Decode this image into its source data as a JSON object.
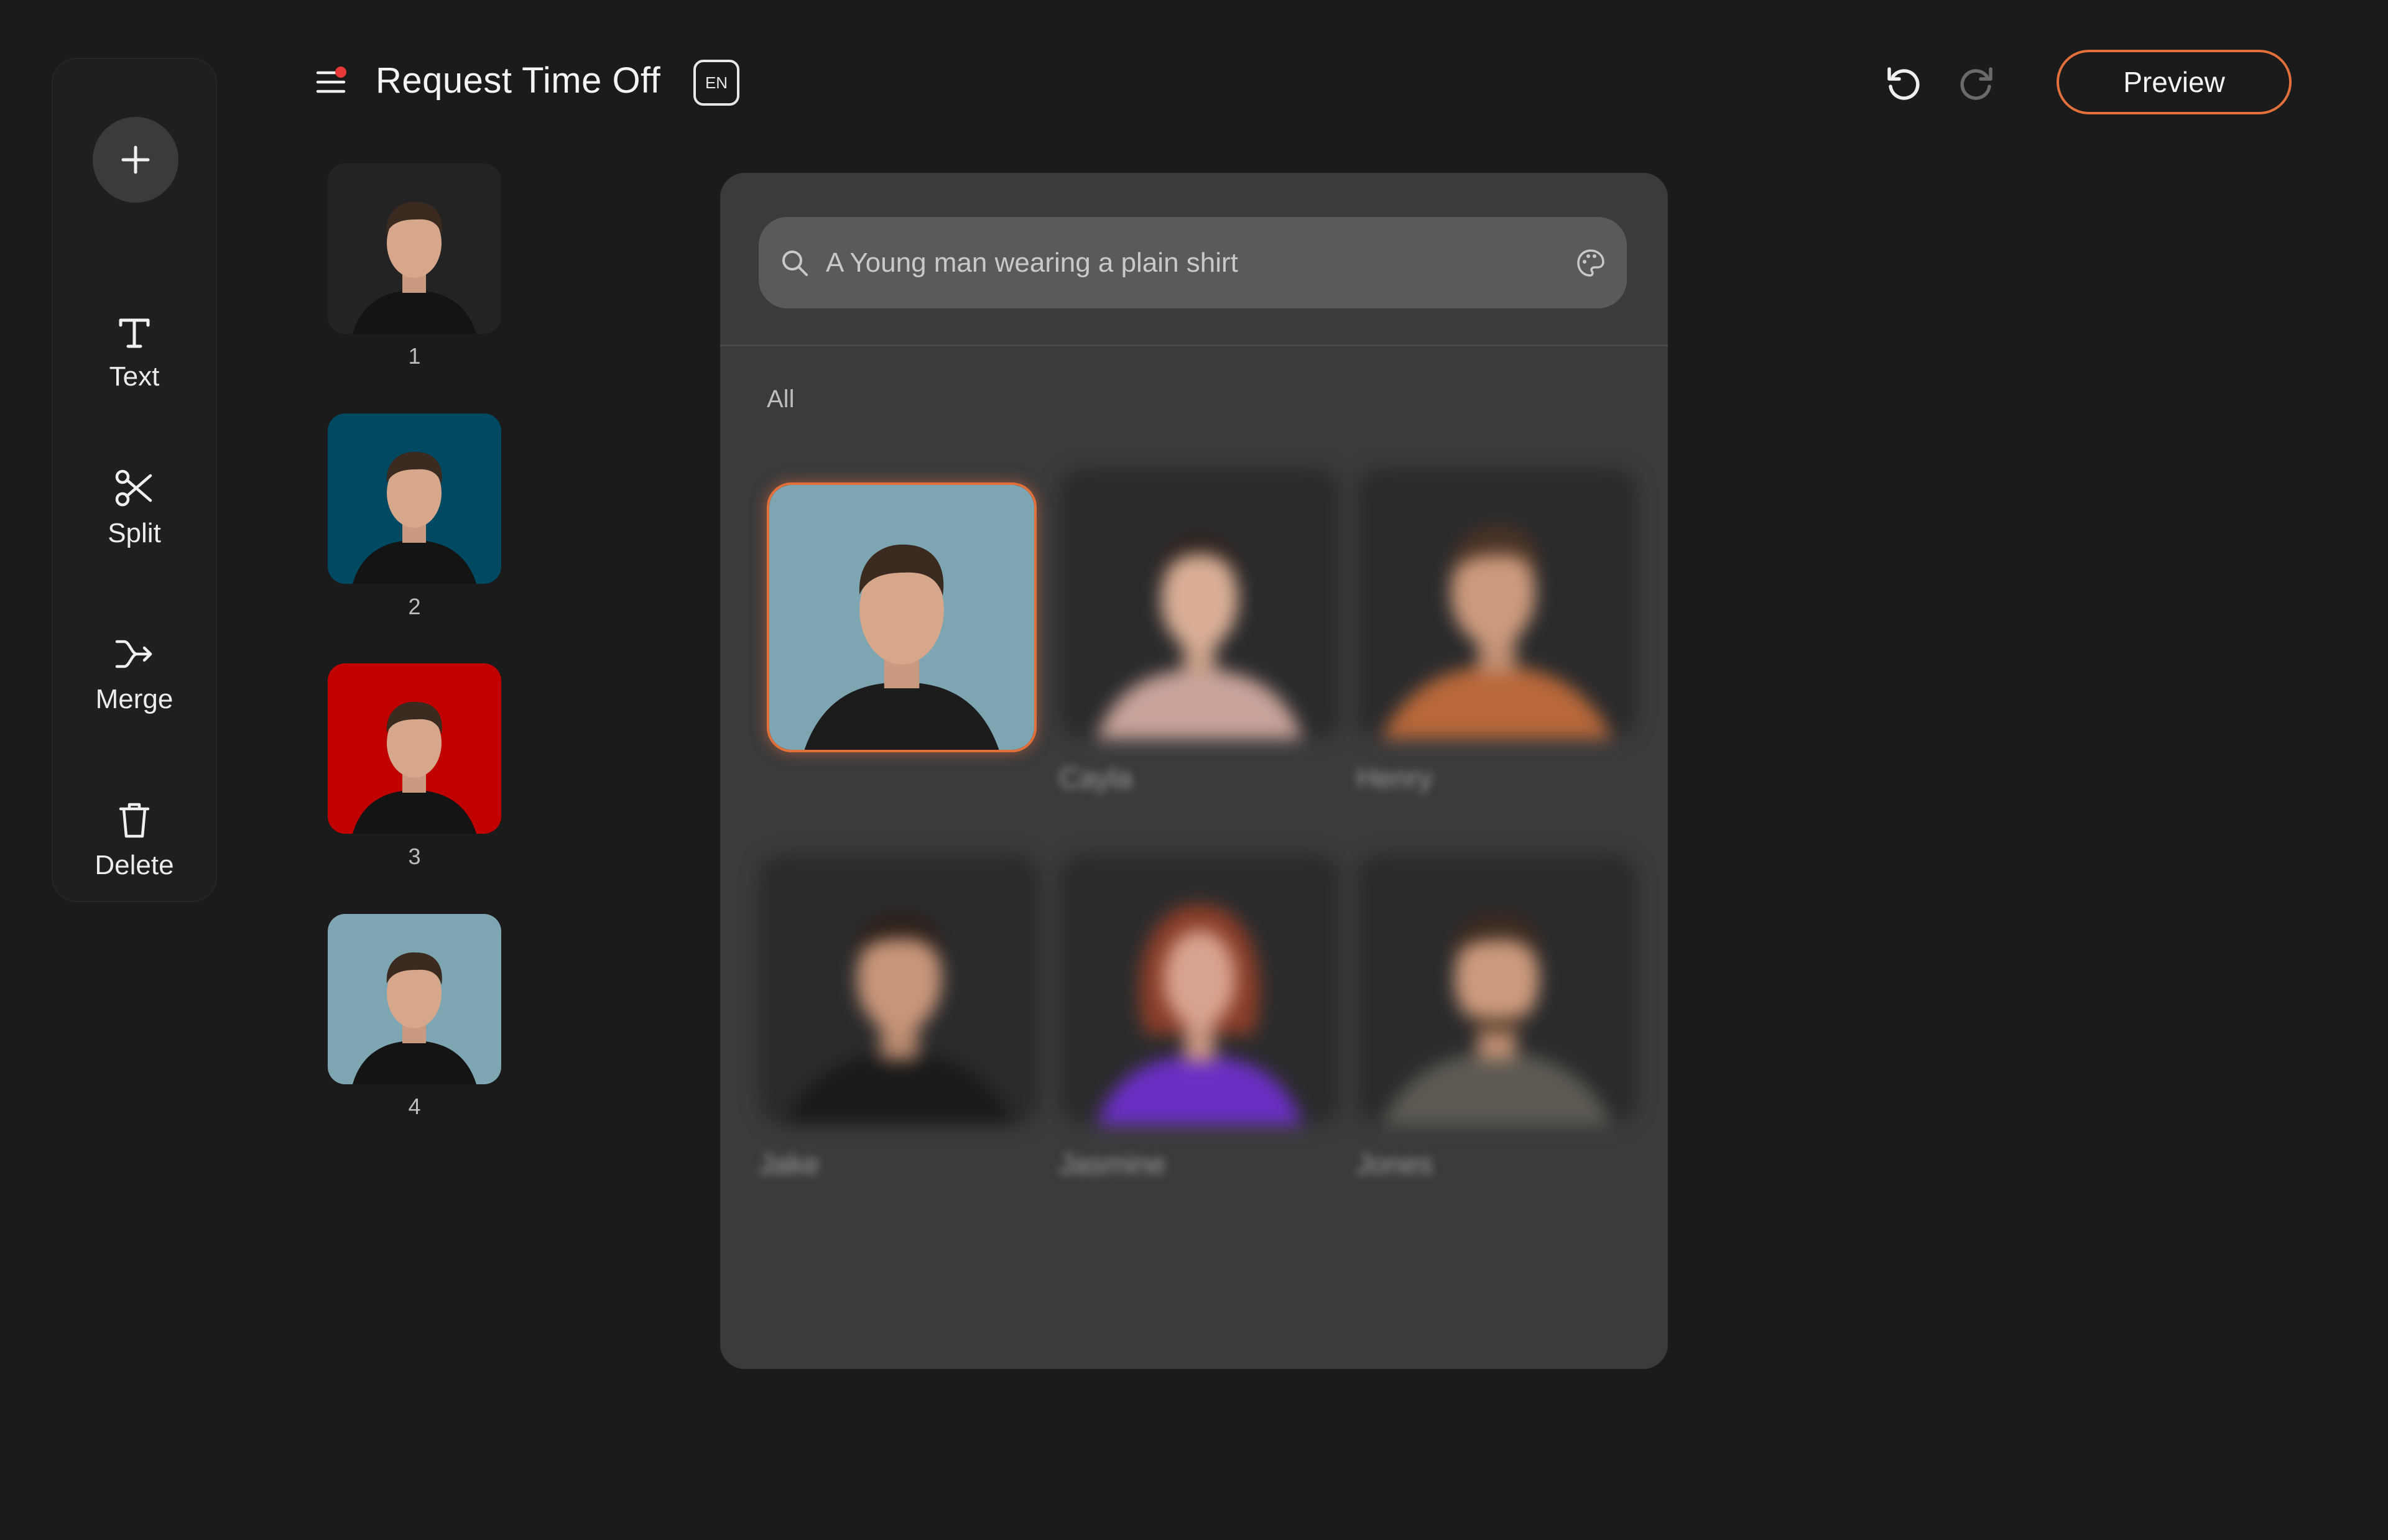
{
  "header": {
    "title": "Request Time Off",
    "language": "EN",
    "preview_label": "Preview"
  },
  "tools": {
    "add_icon": "plus-icon",
    "items": [
      {
        "label": "Text",
        "icon": "text-icon"
      },
      {
        "label": "Split",
        "icon": "scissors-icon"
      },
      {
        "label": "Merge",
        "icon": "merge-icon"
      },
      {
        "label": "Delete",
        "icon": "trash-icon"
      }
    ]
  },
  "slides": [
    {
      "number": "1",
      "background": "#232324"
    },
    {
      "number": "2",
      "background": "#004963"
    },
    {
      "number": "3",
      "background": "#c10000"
    },
    {
      "number": "4",
      "background": "#7ea5b2"
    }
  ],
  "avatar_picker": {
    "search_placeholder": "A Young man wearing a plain shirt",
    "filter": "All",
    "avatars": [
      {
        "name": "",
        "background": "#7ea5b2",
        "shirt": "#1c1c1c",
        "selected": true
      },
      {
        "name": "Cayla",
        "background": "#2b2b2c",
        "shirt": "#c9a39a",
        "selected": false
      },
      {
        "name": "Henry",
        "background": "#2b2b2c",
        "shirt": "#b8683a",
        "selected": false
      },
      {
        "name": "Jake",
        "background": "#2b2b2c",
        "shirt": "#1a1a1a",
        "selected": false
      },
      {
        "name": "Jasmine",
        "background": "#2b2b2c",
        "shirt": "#6a2fc4",
        "selected": false
      },
      {
        "name": "Jones",
        "background": "#2b2b2c",
        "shirt": "#5c5a52",
        "selected": false
      }
    ]
  },
  "colors": {
    "accent": "#e2703a",
    "notification": "#e53935",
    "background": "#1b1b1c",
    "panel": "#3b3b3c"
  }
}
